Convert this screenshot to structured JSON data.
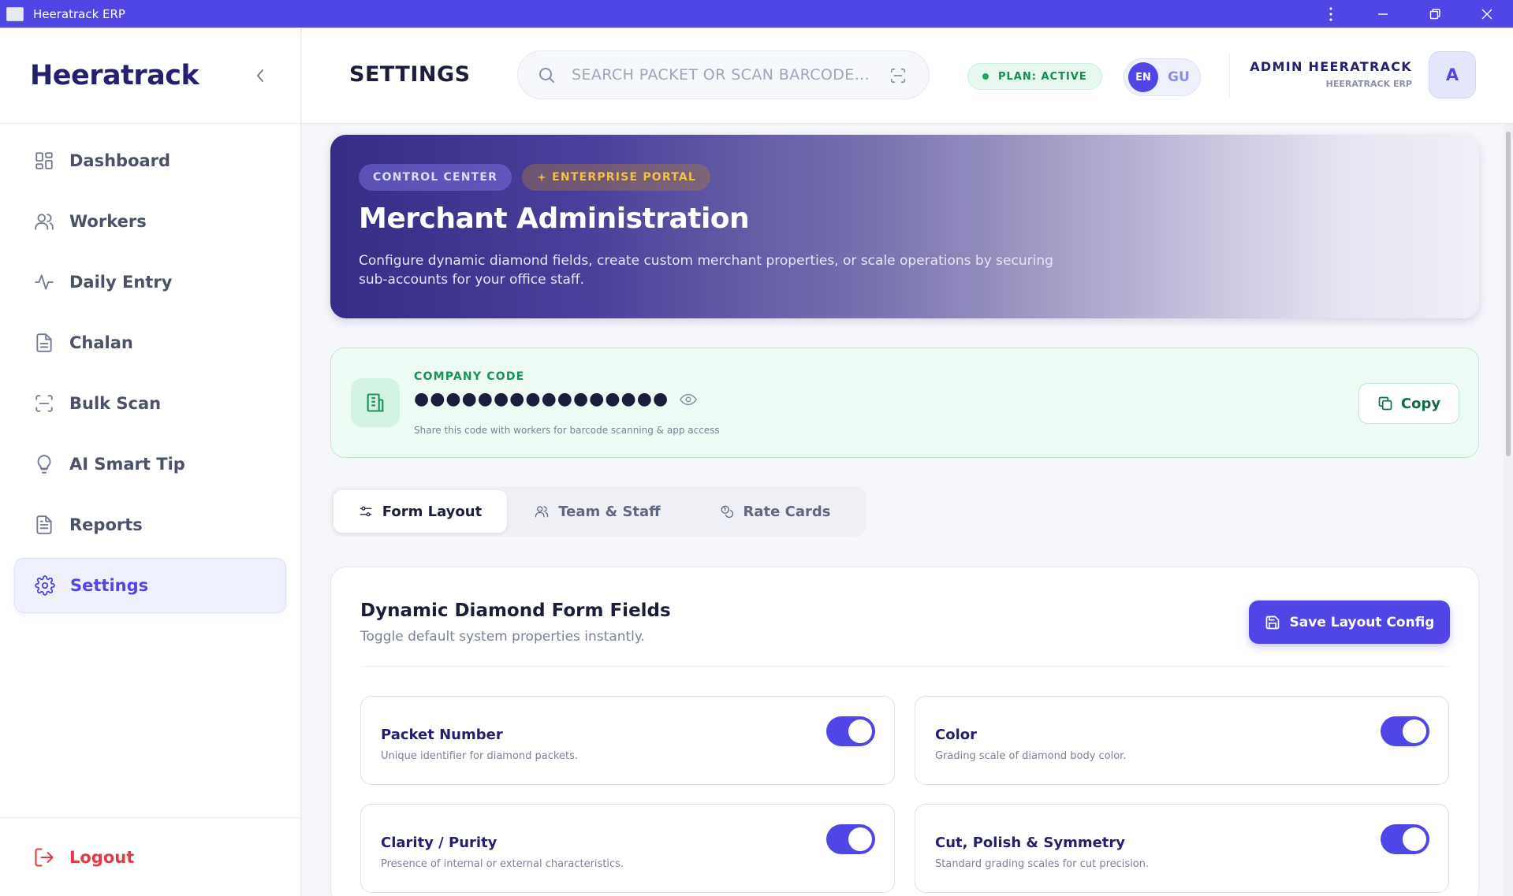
{
  "window": {
    "title": "Heeratrack ERP"
  },
  "sidebar": {
    "brand": "Heeratrack",
    "items": [
      {
        "label": "Dashboard",
        "icon": "grid-icon"
      },
      {
        "label": "Workers",
        "icon": "users-icon"
      },
      {
        "label": "Daily Entry",
        "icon": "activity-icon"
      },
      {
        "label": "Chalan",
        "icon": "document-icon"
      },
      {
        "label": "Bulk Scan",
        "icon": "scan-icon"
      },
      {
        "label": "AI Smart Tip",
        "icon": "lightbulb-icon"
      },
      {
        "label": "Reports",
        "icon": "report-icon"
      },
      {
        "label": "Settings",
        "icon": "gear-icon",
        "active": true
      }
    ],
    "logout": "Logout"
  },
  "header": {
    "title": "SETTINGS",
    "search_placeholder": "SEARCH PACKET OR SCAN BARCODE...",
    "plan_badge": "PLAN: ACTIVE",
    "lang_active": "EN",
    "lang_other": "GU",
    "user_name": "ADMIN HEERATRACK",
    "user_sub": "HEERATRACK ERP",
    "avatar_letter": "A"
  },
  "hero": {
    "chip_control": "CONTROL CENTER",
    "chip_enterprise": "ENTERPRISE PORTAL",
    "title": "Merchant Administration",
    "description": "Configure dynamic diamond fields, create custom merchant properties, or scale operations by securing sub-accounts for your office staff."
  },
  "company": {
    "label": "COMPANY CODE",
    "code_masked": "●●●●●●●●●●●●●●●●",
    "hint": "Share this code with workers for barcode scanning & app access",
    "copy_label": "Copy"
  },
  "tabs": [
    {
      "label": "Form Layout",
      "active": true
    },
    {
      "label": "Team & Staff",
      "active": false
    },
    {
      "label": "Rate Cards",
      "active": false
    }
  ],
  "form": {
    "title": "Dynamic Diamond Form Fields",
    "subtitle": "Toggle default system properties instantly.",
    "save_label": "Save Layout Config",
    "fields": [
      {
        "name": "Packet Number",
        "desc": "Unique identifier for diamond packets.",
        "enabled": true
      },
      {
        "name": "Color",
        "desc": "Grading scale of diamond body color.",
        "enabled": true
      },
      {
        "name": "Clarity / Purity",
        "desc": "Presence of internal or external characteristics.",
        "enabled": true
      },
      {
        "name": "Cut, Polish & Symmetry",
        "desc": "Standard grading scales for cut precision.",
        "enabled": true
      }
    ]
  },
  "colors": {
    "accent": "#4f46e5",
    "success": "#16925a",
    "danger": "#e53946"
  }
}
